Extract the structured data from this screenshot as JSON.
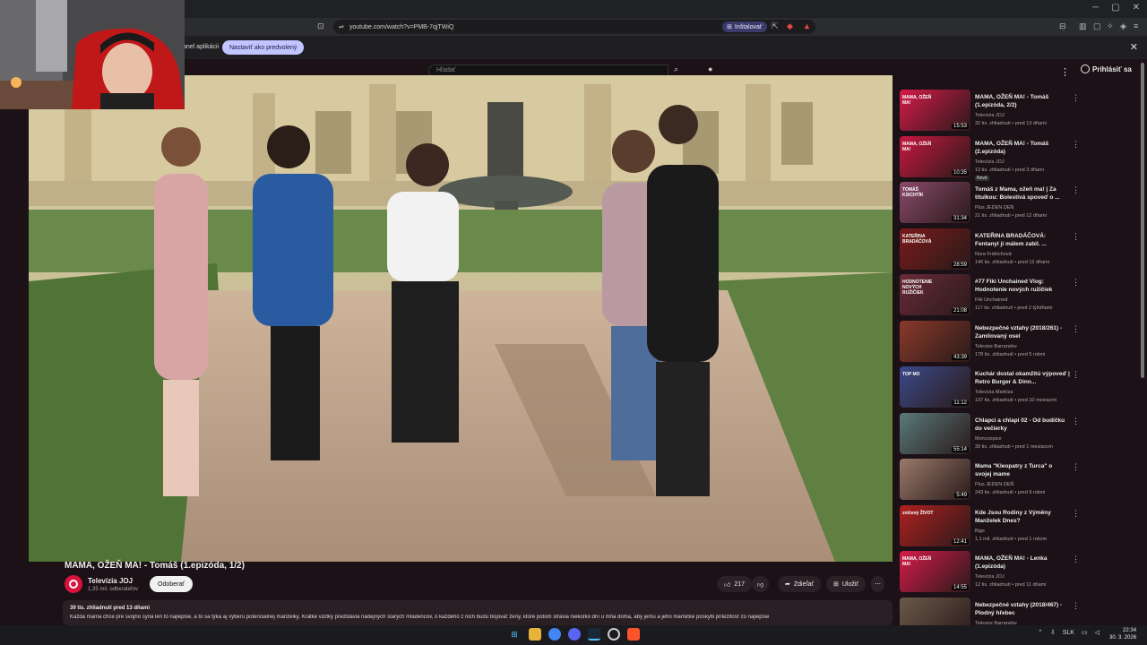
{
  "browser": {
    "url": "youtube.com/watch?v=PMB-7qjTWiQ",
    "install_label": "Inštalovať",
    "infobar_text": "anel aplikácii",
    "infobar_button": "Nastaviť ako predvolený",
    "close_glyph": "✕"
  },
  "youtube": {
    "search_placeholder": "Hľadať",
    "signin_label": "Prihlásiť sa"
  },
  "video": {
    "title": "MAMA, OŽEŇ MA! - Tomáš (1.epizóda, 1/2)",
    "channel_name": "Televízia JOJ",
    "channel_subs": "1,35 mil. odberateľov",
    "subscribe_label": "Odoberať",
    "likes": "217",
    "share_label": "Zdieľať",
    "save_label": "Uložiť",
    "meta": "39 tis. zhliadnutí  pred 13 dňami",
    "description": "Každá mama chce pre svojho syna len to najlepšie, a to sa týka aj výberu potenciálnej manželky. Krátke vizitky predstavia nádejných starých mládencov, o každého z nich budú bojovať ženy, ktoré potom strávia niekoľko dní u mňa doma, aby jemu a jeho mamičke poskytli príležitosť čo najlepšie"
  },
  "recommendations": [
    {
      "title": "MAMA, OŽEŇ MA! - Tomáš (1.epizóda, 2/2)",
      "channel": "Televízia JOJ",
      "meta": "32 tis. zhliadnutí • pred 13 dňami",
      "duration": "15:53",
      "badge": "",
      "color": "#d61b4a"
    },
    {
      "title": "MAMA, OŽEŇ MA! - Tomáš (2.epizóda)",
      "channel": "Televízia JOJ",
      "meta": "13 tis. zhliadnutí • pred 3 dňami",
      "duration": "10:35",
      "badge": "Nové",
      "color": "#c8183f"
    },
    {
      "title": "Tomáš z Mama, ožeň ma! | Za titulkou: Bolestivá spoveď o ...",
      "channel": "Plus JEDEN DEŇ",
      "meta": "21 tis. zhliadnutí • pred 12 dňami",
      "duration": "31:34",
      "badge": "",
      "color": "#8a4a6a"
    },
    {
      "title": "KATEŘINA BRADÁČOVÁ: Fentanyl jí málem zabil. ...",
      "channel": "Nora Fridrichová",
      "meta": "146 tis. zhliadnutí • pred 12 dňami",
      "duration": "28:59",
      "badge": "",
      "color": "#7a1a1a"
    },
    {
      "title": "#77 Fiki Unchained Vlog: Hodnotenie nových ružičiek",
      "channel": "Fiki Unchained",
      "meta": "117 tis. zhliadnutí • pred 2 týždňami",
      "duration": "21:08",
      "badge": "",
      "color": "#6a2a3a"
    },
    {
      "title": "Nebezpečné vztahy (2018/261) - Zamilovaný osel",
      "channel": "Televize Barrandov",
      "meta": "178 tis. zhliadnutí • pred 5 rokmi",
      "duration": "43:39",
      "badge": "",
      "color": "#8a3a2a"
    },
    {
      "title": "Kuchár dostal okamžitú výpoveď | Retro Burger & Dinn...",
      "channel": "Televízia Markíza",
      "meta": "137 tis. zhliadnutí • pred 10 mesiacmi",
      "duration": "11:12",
      "badge": "",
      "color": "#3a4a8a"
    },
    {
      "title": "Chlapci a chlapi 02 - Od budíčku do večierky",
      "channel": "Moncoopice",
      "meta": "39 tis. zhliadnutí • pred 1 mesiacom",
      "duration": "55:14",
      "badge": "",
      "color": "#5a7a7a"
    },
    {
      "title": "Mama \"Kleopatry z Turca\" o svojej mame",
      "channel": "Plus JEDEN DEŇ",
      "meta": "243 tis. zhliadnutí • pred 9 rokmi",
      "duration": "5:49",
      "badge": "",
      "color": "#9a7a6a"
    },
    {
      "title": "Kde Jsou Rodiny z Výměny Manželek Dnes?",
      "channel": "Bige",
      "meta": "1,1 mil. zhliadnutí • pred 1 rokom",
      "duration": "12:41",
      "badge": "",
      "color": "#b02020"
    },
    {
      "title": "MAMA, OŽEŇ MA! - Lenka (1.epizóda)",
      "channel": "Televízia JOJ",
      "meta": "12 tis. zhliadnutí • pred 11 dňami",
      "duration": "14:55",
      "badge": "",
      "color": "#d61b4a"
    },
    {
      "title": "Nebezpečné vztahy (2018/467) - Plodný hřebec",
      "channel": "Televize Barrandov",
      "meta": "",
      "duration": "",
      "badge": "",
      "color": "#6a5a4a"
    }
  ],
  "thumb_texts": {
    "t0": "MAMA, OŽEŇ MA!",
    "t1": "MAMA, OŽEŇ MA!",
    "t2": "TOMÁŠ KSICHTÍK",
    "t3": "KATEŘINA BRADÁČOVÁ",
    "t4": "HODNOTENIE NOVÝCH RUŽIČIEK",
    "t6": "TOP MO",
    "t9": "zničený ŽIVOT",
    "t10": "MAMA, OŽEŇ MA!"
  },
  "taskbar": {
    "lang": "SLK",
    "time": "22:34",
    "date": "30. 3. 2026"
  }
}
